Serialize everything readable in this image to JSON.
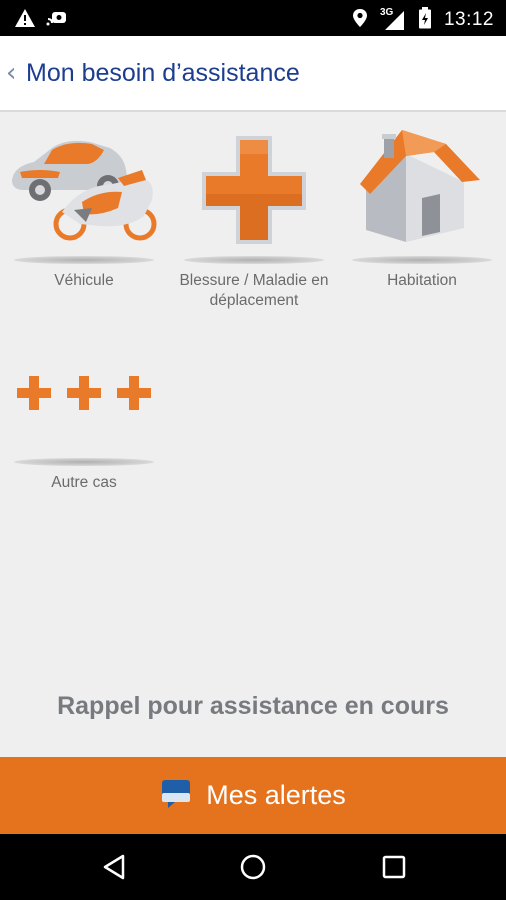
{
  "status_bar": {
    "time": "13:12",
    "network": "3G",
    "left_icons": [
      "warning-icon",
      "cast-icon"
    ],
    "right_icons": [
      "location-icon",
      "signal-icon",
      "battery-icon"
    ]
  },
  "header": {
    "back_icon": "chevron-left-icon",
    "title": "Mon besoin d’assistance"
  },
  "categories": [
    {
      "label": "Véhicule",
      "icon": "vehicle-icon"
    },
    {
      "label": "Blessure / Maladie en déplacement",
      "icon": "medical-cross-icon"
    },
    {
      "label": "Habitation",
      "icon": "house-icon"
    },
    {
      "label": "Autre cas",
      "icon": "three-crosses-icon"
    }
  ],
  "rappel_text": "Rappel pour assistance en cours",
  "alerts_button": {
    "label": "Mes alertes",
    "icon": "chat-bubble-icon"
  },
  "colors": {
    "accent": "#e5731d",
    "title_blue": "#1d3d8f",
    "background": "#efefef"
  },
  "nav_bar": [
    "back-icon",
    "home-icon",
    "recents-icon"
  ]
}
